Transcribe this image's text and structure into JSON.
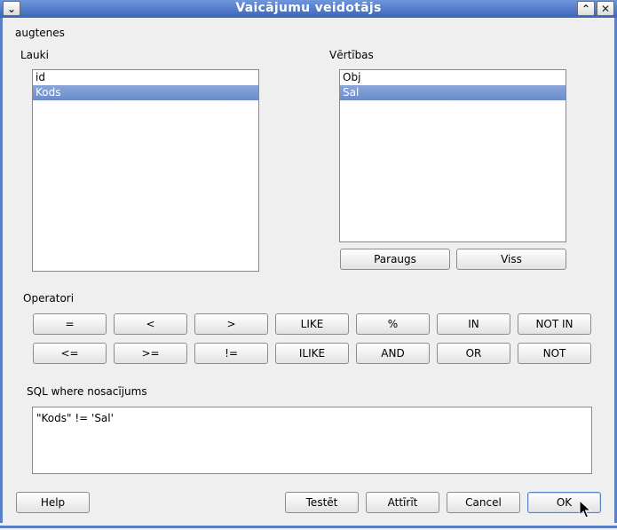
{
  "window": {
    "title": "Vaicājumu veidotājs"
  },
  "layer_name": "augtenes",
  "fields": {
    "label": "Lauki",
    "items": [
      {
        "text": "id",
        "selected": false
      },
      {
        "text": "Kods",
        "selected": true
      }
    ]
  },
  "values": {
    "label": "Vērtības",
    "items": [
      {
        "text": "Obj",
        "selected": false
      },
      {
        "text": "Sal",
        "selected": true
      }
    ],
    "sample_label": "Paraugs",
    "all_label": "Viss"
  },
  "operators": {
    "label": "Operatori",
    "row1": [
      "=",
      "<",
      ">",
      "LIKE",
      "%",
      "IN",
      "NOT IN"
    ],
    "row2": [
      "<=",
      ">=",
      "!=",
      "ILIKE",
      "AND",
      "OR",
      "NOT"
    ]
  },
  "sql": {
    "label": "SQL where nosacījums",
    "value": "\"Kods\" != 'Sal'"
  },
  "buttons": {
    "help": "Help",
    "test": "Testēt",
    "clear": "Attīrīt",
    "cancel": "Cancel",
    "ok": "OK"
  },
  "colors": {
    "title_bar": "#4a72c4",
    "selection": "#7b99d3"
  }
}
